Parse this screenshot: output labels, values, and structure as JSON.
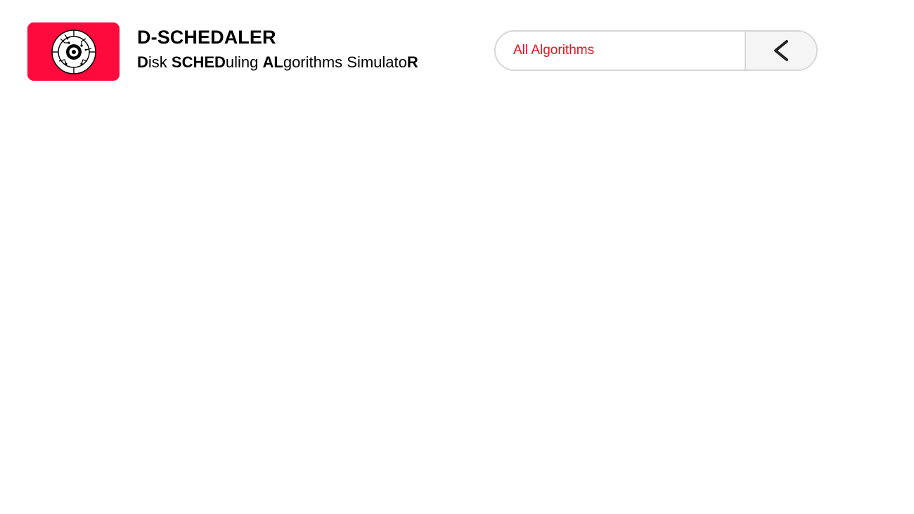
{
  "header": {
    "title": "D-SCHEDALER",
    "subtitle_parts": {
      "p1_bold": "D",
      "p2": "isk ",
      "p3_bold": "SCHED",
      "p4": "uling ",
      "p5_bold": "AL",
      "p6": "gorithms Simulato",
      "p7_bold": "R"
    },
    "logo_icon": "disk-circuit-icon",
    "logo_color": "#ff0a3c"
  },
  "algorithm_selector": {
    "selected": "All Algorithms",
    "selected_color": "#e8101c",
    "toggle_icon": "chevron-left-icon"
  }
}
